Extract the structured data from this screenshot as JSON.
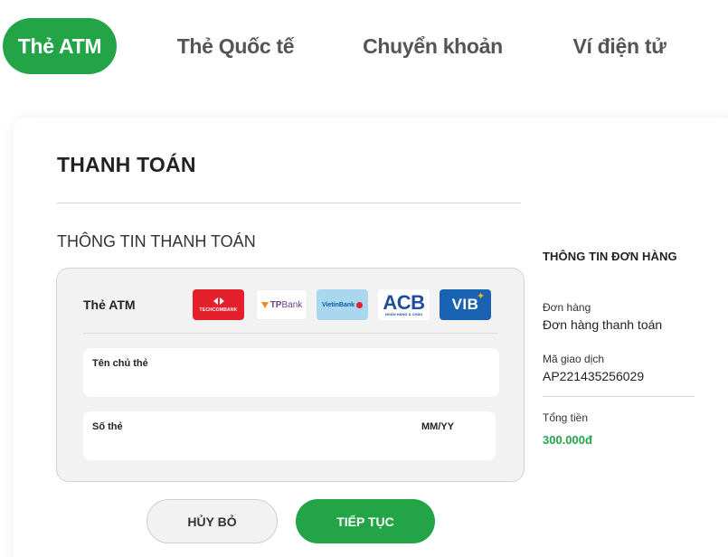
{
  "tabs": [
    {
      "label": "Thẻ ATM",
      "active": true
    },
    {
      "label": "Thẻ Quốc tế",
      "active": false
    },
    {
      "label": "Chuyển khoản",
      "active": false
    },
    {
      "label": "Ví điện tử",
      "active": false
    }
  ],
  "payment": {
    "title": "THANH TOÁN",
    "section_title": "THÔNG TIN THANH TOÁN",
    "card_type_label": "Thẻ ATM",
    "banks": [
      {
        "name": "TECHCOMBANK",
        "icon": "techcombank-logo"
      },
      {
        "name": "TPBank",
        "prefix": "TP",
        "suffix": "Bank",
        "icon": "tpbank-logo"
      },
      {
        "name": "VietinBank",
        "icon": "vietinbank-logo"
      },
      {
        "name": "ACB",
        "sub": "NGÂN HÀNG Á CHÂU",
        "icon": "acb-logo"
      },
      {
        "name": "VIB",
        "icon": "vib-logo"
      }
    ],
    "cardholder_label": "Tên chủ thẻ",
    "cardholder_value": "",
    "card_number_label": "Số thẻ",
    "card_number_value": "",
    "expiry_label": "MM/YY",
    "expiry_value": ""
  },
  "buttons": {
    "cancel": "HỦY BỎ",
    "continue": "TIẾP TỤC"
  },
  "order": {
    "title": "THÔNG TIN ĐƠN HÀNG",
    "order_label": "Đơn hàng",
    "order_value": "Đơn hàng thanh toán",
    "transaction_label": "Mã giao dịch",
    "transaction_value": "AP221435256029",
    "total_label": "Tổng tiền",
    "total_value": "300.000đ"
  },
  "colors": {
    "accent": "#22a447",
    "techcombank": "#e3202b",
    "vib": "#1a63b2",
    "vietinbank": "#a9d7ef"
  }
}
